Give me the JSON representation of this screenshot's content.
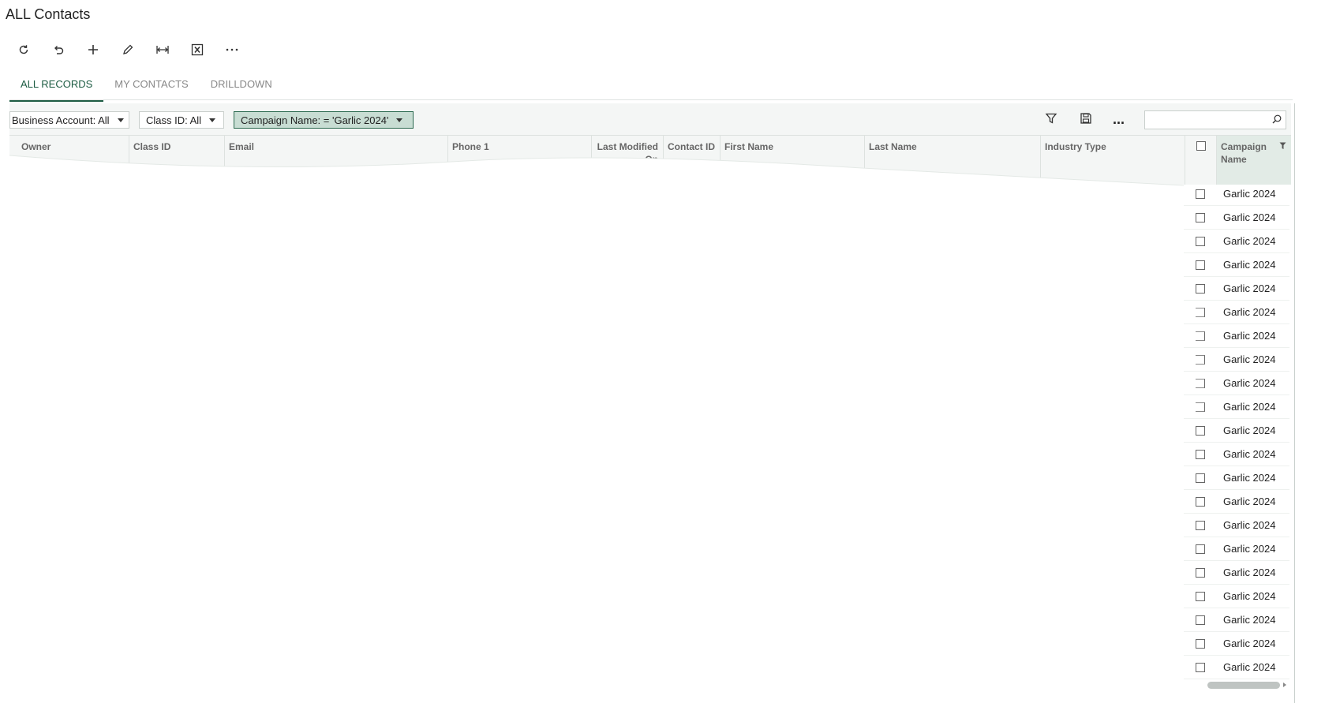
{
  "page": {
    "title": "ALL Contacts"
  },
  "toolbar": {
    "items": [
      {
        "name": "refresh-icon"
      },
      {
        "name": "undo-icon"
      },
      {
        "name": "add-icon"
      },
      {
        "name": "edit-icon"
      },
      {
        "name": "fit-columns-icon"
      },
      {
        "name": "export-excel-icon"
      },
      {
        "name": "more-icon"
      }
    ]
  },
  "tabs": [
    {
      "label": "ALL RECORDS",
      "active": true
    },
    {
      "label": "MY CONTACTS",
      "active": false
    },
    {
      "label": "DRILLDOWN",
      "active": false
    }
  ],
  "filters": {
    "business_account": "Business Account: All",
    "class_id": "Class ID: All",
    "campaign_name": "Campaign Name: = 'Garlic 2024'",
    "more_label": "...",
    "search_value": ""
  },
  "columns": {
    "owner": "Owner",
    "class_id": "Class ID",
    "email": "Email",
    "phone1": "Phone 1",
    "last_modified": "Last Modified On",
    "contact_id": "Contact ID",
    "first_name": "First Name",
    "last_name": "Last Name",
    "industry_type": "Industry Type",
    "campaign_name": "Campaign Name"
  },
  "rows": [
    {
      "campaign": "Garlic 2024"
    },
    {
      "campaign": "Garlic 2024"
    },
    {
      "campaign": "Garlic 2024"
    },
    {
      "campaign": "Garlic 2024"
    },
    {
      "campaign": "Garlic 2024"
    },
    {
      "campaign": "Garlic 2024"
    },
    {
      "campaign": "Garlic 2024"
    },
    {
      "campaign": "Garlic 2024"
    },
    {
      "campaign": "Garlic 2024"
    },
    {
      "campaign": "Garlic 2024"
    },
    {
      "campaign": "Garlic 2024"
    },
    {
      "campaign": "Garlic 2024"
    },
    {
      "campaign": "Garlic 2024"
    },
    {
      "campaign": "Garlic 2024"
    },
    {
      "campaign": "Garlic 2024"
    },
    {
      "campaign": "Garlic 2024"
    },
    {
      "campaign": "Garlic 2024"
    },
    {
      "campaign": "Garlic 2024"
    },
    {
      "campaign": "Garlic 2024"
    },
    {
      "campaign": "Garlic 2024"
    },
    {
      "campaign": "Garlic 2024"
    }
  ],
  "colors": {
    "accent": "#1d5c43",
    "active_filter_bg": "#c8ddd3",
    "header_bg": "#f4f6f5"
  }
}
